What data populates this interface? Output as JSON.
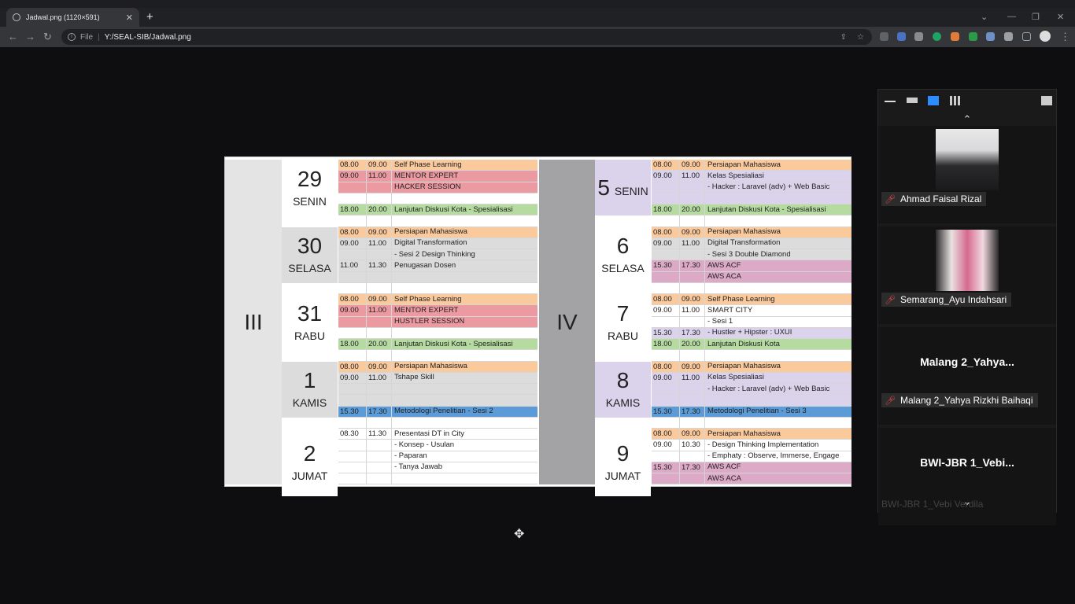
{
  "browser": {
    "tab_title": "Jadwal.png (1120×591)",
    "address_prefix": "File",
    "address": "Y:/SEAL-SIB/Jadwal.png"
  },
  "schedule": {
    "week_left": "III",
    "week_right": "IV",
    "days_left": [
      {
        "num": "29",
        "name": "SENIN"
      },
      {
        "num": "30",
        "name": "SELASA"
      },
      {
        "num": "31",
        "name": "RABU"
      },
      {
        "num": "1",
        "name": "KAMIS"
      },
      {
        "num": "2",
        "name": "JUMAT"
      }
    ],
    "days_right": [
      {
        "num": "5",
        "name": "SENIN"
      },
      {
        "num": "6",
        "name": "SELASA"
      },
      {
        "num": "7",
        "name": "RABU"
      },
      {
        "num": "8",
        "name": "KAMIS"
      },
      {
        "num": "9",
        "name": "JUMAT"
      }
    ],
    "rows_left": [
      {
        "t1": "08.00",
        "t2": "09.00",
        "text": "Self Phase Learning",
        "color": "or"
      },
      {
        "t1": "09.00",
        "t2": "11.00",
        "text": "MENTOR EXPERT",
        "color": "rd"
      },
      {
        "t1": "",
        "t2": "",
        "text": "HACKER SESSION",
        "color": "rd"
      },
      {
        "t1": "",
        "t2": "",
        "text": "",
        "color": "wh"
      },
      {
        "t1": "18.00",
        "t2": "20.00",
        "text": "Lanjutan Diskusi Kota - Spesialisasi",
        "color": "gr"
      },
      {
        "t1": "",
        "t2": "",
        "text": "",
        "color": "wh"
      },
      {
        "t1": "08.00",
        "t2": "09.00",
        "text": "Persiapan Mahasiswa",
        "color": "or"
      },
      {
        "t1": "09.00",
        "t2": "11.00",
        "text": "Digital Transformation",
        "color": "gy"
      },
      {
        "t1": "",
        "t2": "",
        "text": "- Sesi 2 Design Thinking",
        "color": "gy"
      },
      {
        "t1": "11.00",
        "t2": "11.30",
        "text": "Penugasan Dosen",
        "color": "gy"
      },
      {
        "t1": "",
        "t2": "",
        "text": "",
        "color": "gy"
      },
      {
        "t1": "",
        "t2": "",
        "text": "",
        "color": "wh"
      },
      {
        "t1": "08.00",
        "t2": "09.00",
        "text": "Self Phase Learning",
        "color": "or"
      },
      {
        "t1": "09.00",
        "t2": "11.00",
        "text": "MENTOR EXPERT",
        "color": "rd"
      },
      {
        "t1": "",
        "t2": "",
        "text": "HUSTLER SESSION",
        "color": "rd"
      },
      {
        "t1": "",
        "t2": "",
        "text": "",
        "color": "wh"
      },
      {
        "t1": "18.00",
        "t2": "20.00",
        "text": "Lanjutan Diskusi Kota - Spesialisasi",
        "color": "gr"
      },
      {
        "t1": "",
        "t2": "",
        "text": "",
        "color": "wh"
      },
      {
        "t1": "08.00",
        "t2": "09.00",
        "text": "Persiapan Mahasiswa",
        "color": "or"
      },
      {
        "t1": "09.00",
        "t2": "11.00",
        "text": "Tshape Skill",
        "color": "gy"
      },
      {
        "t1": "",
        "t2": "",
        "text": "",
        "color": "gy"
      },
      {
        "t1": "",
        "t2": "",
        "text": "",
        "color": "gy"
      },
      {
        "t1": "15.30",
        "t2": "17.30",
        "text": "Metodologi Penelitian - Sesi 2",
        "color": "bl"
      },
      {
        "t1": "",
        "t2": "",
        "text": "",
        "color": "wh"
      },
      {
        "t1": "08.30",
        "t2": "11.30",
        "text": "Presentasi DT in City",
        "color": "wh"
      },
      {
        "t1": "",
        "t2": "",
        "text": "- Konsep - Usulan",
        "color": "wh"
      },
      {
        "t1": "",
        "t2": "",
        "text": "- Paparan",
        "color": "wh"
      },
      {
        "t1": "",
        "t2": "",
        "text": "- Tanya Jawab",
        "color": "wh"
      },
      {
        "t1": "",
        "t2": "",
        "text": "",
        "color": "wh"
      }
    ],
    "rows_right": [
      {
        "t1": "08.00",
        "t2": "09.00",
        "text": "Persiapan Mahasiswa",
        "color": "or"
      },
      {
        "t1": "09.00",
        "t2": "11.00",
        "text": "Kelas Spesialiasi",
        "color": "lv"
      },
      {
        "t1": "",
        "t2": "",
        "text": "- Hacker : Laravel (adv) + Web Basic",
        "color": "lv"
      },
      {
        "t1": "",
        "t2": "",
        "text": "",
        "color": "lv"
      },
      {
        "t1": "18.00",
        "t2": "20.00",
        "text": "Lanjutan Diskusi Kota - Spesialisasi",
        "color": "gr"
      },
      {
        "t1": "",
        "t2": "",
        "text": "",
        "color": "wh"
      },
      {
        "t1": "08.00",
        "t2": "09.00",
        "text": "Persiapan Mahasiswa",
        "color": "or"
      },
      {
        "t1": "09.00",
        "t2": "11.00",
        "text": "Digital Transformation",
        "color": "gy"
      },
      {
        "t1": "",
        "t2": "",
        "text": "- Sesi 3 Double Diamond",
        "color": "gy"
      },
      {
        "t1": "15.30",
        "t2": "17.30",
        "text": "AWS ACF",
        "color": "pk"
      },
      {
        "t1": "",
        "t2": "",
        "text": "AWS ACA",
        "color": "pk"
      },
      {
        "t1": "",
        "t2": "",
        "text": "",
        "color": "wh"
      },
      {
        "t1": "08.00",
        "t2": "09.00",
        "text": "Self Phase Learning",
        "color": "or"
      },
      {
        "t1": "09.00",
        "t2": "11.00",
        "text": "SMART CITY",
        "color": "wh"
      },
      {
        "t1": "",
        "t2": "",
        "text": "- Sesi 1",
        "color": "wh"
      },
      {
        "t1": "15.30",
        "t2": "17.30",
        "text": "- Hustler + Hipster : UXUI",
        "color": "lv"
      },
      {
        "t1": "18.00",
        "t2": "20.00",
        "text": "Lanjutan Diskusi Kota",
        "color": "gr"
      },
      {
        "t1": "",
        "t2": "",
        "text": "",
        "color": "wh"
      },
      {
        "t1": "08.00",
        "t2": "09.00",
        "text": "Persiapan Mahasiswa",
        "color": "or"
      },
      {
        "t1": "09.00",
        "t2": "11.00",
        "text": "Kelas Spesialiasi",
        "color": "lv"
      },
      {
        "t1": "",
        "t2": "",
        "text": "- Hacker : Laravel (adv) + Web Basic",
        "color": "lv"
      },
      {
        "t1": "",
        "t2": "",
        "text": "",
        "color": "lv"
      },
      {
        "t1": "15.30",
        "t2": "17.30",
        "text": "Metodologi Penelitian - Sesi 3",
        "color": "bl"
      },
      {
        "t1": "",
        "t2": "",
        "text": "",
        "color": "wh"
      },
      {
        "t1": "08.00",
        "t2": "09.00",
        "text": "Persiapan Mahasiswa",
        "color": "or"
      },
      {
        "t1": "09.00",
        "t2": "10.30",
        "text": "- Design Thinking Implementation",
        "color": "wh"
      },
      {
        "t1": "",
        "t2": "",
        "text": "- Emphaty : Observe, Immerse, Engage",
        "color": "wh"
      },
      {
        "t1": "15.30",
        "t2": "17.30",
        "text": "AWS ACF",
        "color": "pk"
      },
      {
        "t1": "",
        "t2": "",
        "text": "AWS ACA",
        "color": "pk"
      }
    ]
  },
  "zoom_panel": {
    "participants": [
      {
        "big": "",
        "label": "Ahmad Faisal Rizal",
        "photo": "man-dark-shirt"
      },
      {
        "big": "",
        "label": "Semarang_Ayu Indahsari",
        "photo": "woman-hijab-pink"
      },
      {
        "big": "Malang  2_Yahya...",
        "label": "Malang 2_Yahya Rizkhi Baihaqi",
        "photo": ""
      },
      {
        "big": "BWI-JBR  1_Vebi...",
        "label": "",
        "photo": ""
      }
    ],
    "cut_label": "BWI-JBR 1_Vebi Verdila"
  },
  "colors": {
    "orange": "#fac99c",
    "red": "#ec9aa1",
    "green": "#b5dba1",
    "gray": "#dcdcdc",
    "blue": "#5a9bd8",
    "pink": "#dcaac6",
    "lavender": "#dbd2ec"
  }
}
